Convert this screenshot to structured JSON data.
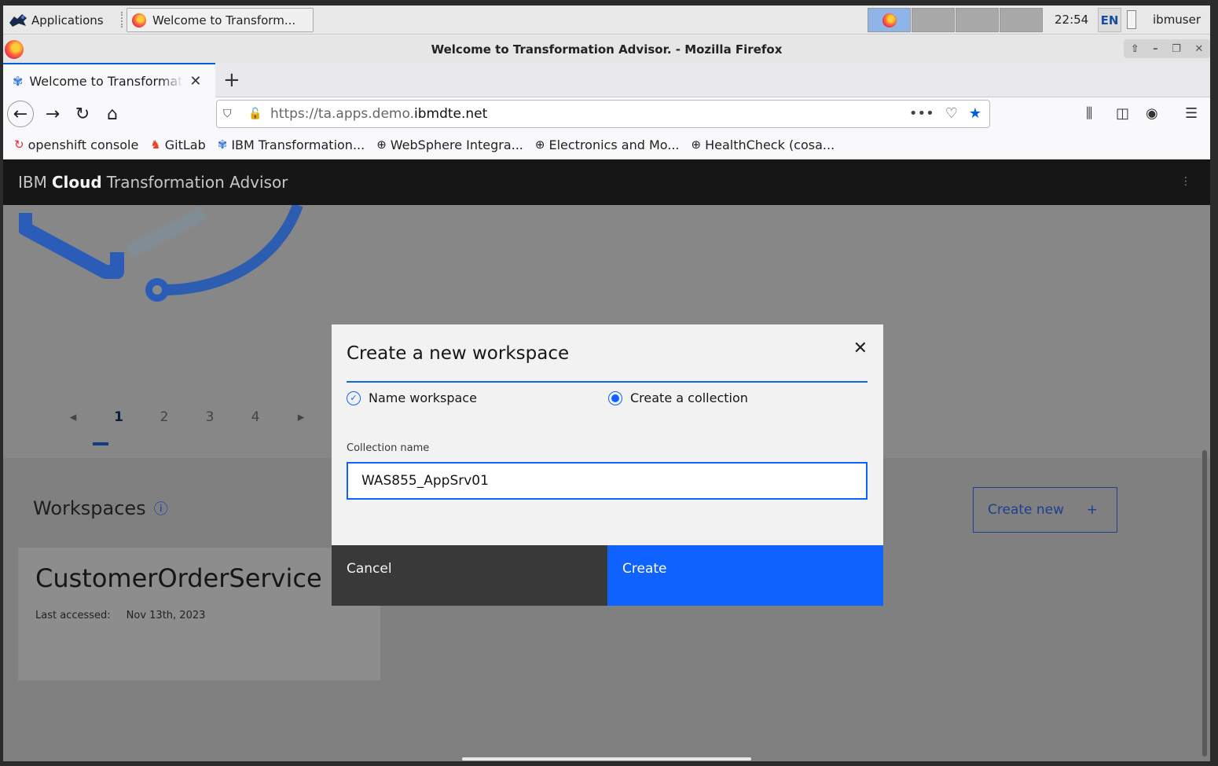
{
  "panel": {
    "applications_label": "Applications",
    "task_label": "Welcome to Transform...",
    "clock": "22:54",
    "language": "EN",
    "user": "ibmuser"
  },
  "window": {
    "title": "Welcome to Transformation Advisor. - Mozilla Firefox"
  },
  "tabs": [
    {
      "label": "Welcome to Transformation Advisor"
    }
  ],
  "urlbar": {
    "prefix": "https://ta.apps.demo.",
    "domain": "ibmdte.net",
    "more": "•••"
  },
  "bookmarks": [
    {
      "label": "openshift console",
      "icon": "openshift-icon"
    },
    {
      "label": "GitLab",
      "icon": "gitlab-icon"
    },
    {
      "label": "IBM Transformation...",
      "icon": "ta-icon"
    },
    {
      "label": "WebSphere Integra...",
      "icon": "globe-icon"
    },
    {
      "label": "Electronics and Mo...",
      "icon": "globe-icon"
    },
    {
      "label": "HealthCheck (cosa...",
      "icon": "globe-icon"
    }
  ],
  "app": {
    "brand_prefix": "IBM",
    "brand_bold": "Cloud",
    "brand_suffix": "Transformation Advisor",
    "carousel_pages": [
      "1",
      "2",
      "3",
      "4"
    ],
    "carousel_current": "1",
    "workspaces_title": "Workspaces",
    "create_new_label": "Create new",
    "card": {
      "title": "CustomerOrderService",
      "last_accessed_label": "Last accessed:",
      "last_accessed_value": "Nov 13th, 2023"
    }
  },
  "modal": {
    "title": "Create a new workspace",
    "steps": [
      {
        "label": "Name workspace",
        "state": "complete"
      },
      {
        "label": "Create a collection",
        "state": "current"
      }
    ],
    "field_label": "Collection name",
    "field_value": "WAS855_AppSrv01",
    "cancel_label": "Cancel",
    "create_label": "Create"
  },
  "colors": {
    "accent": "#0f62fe",
    "header_bg": "#161616",
    "overlay": "#878787"
  }
}
